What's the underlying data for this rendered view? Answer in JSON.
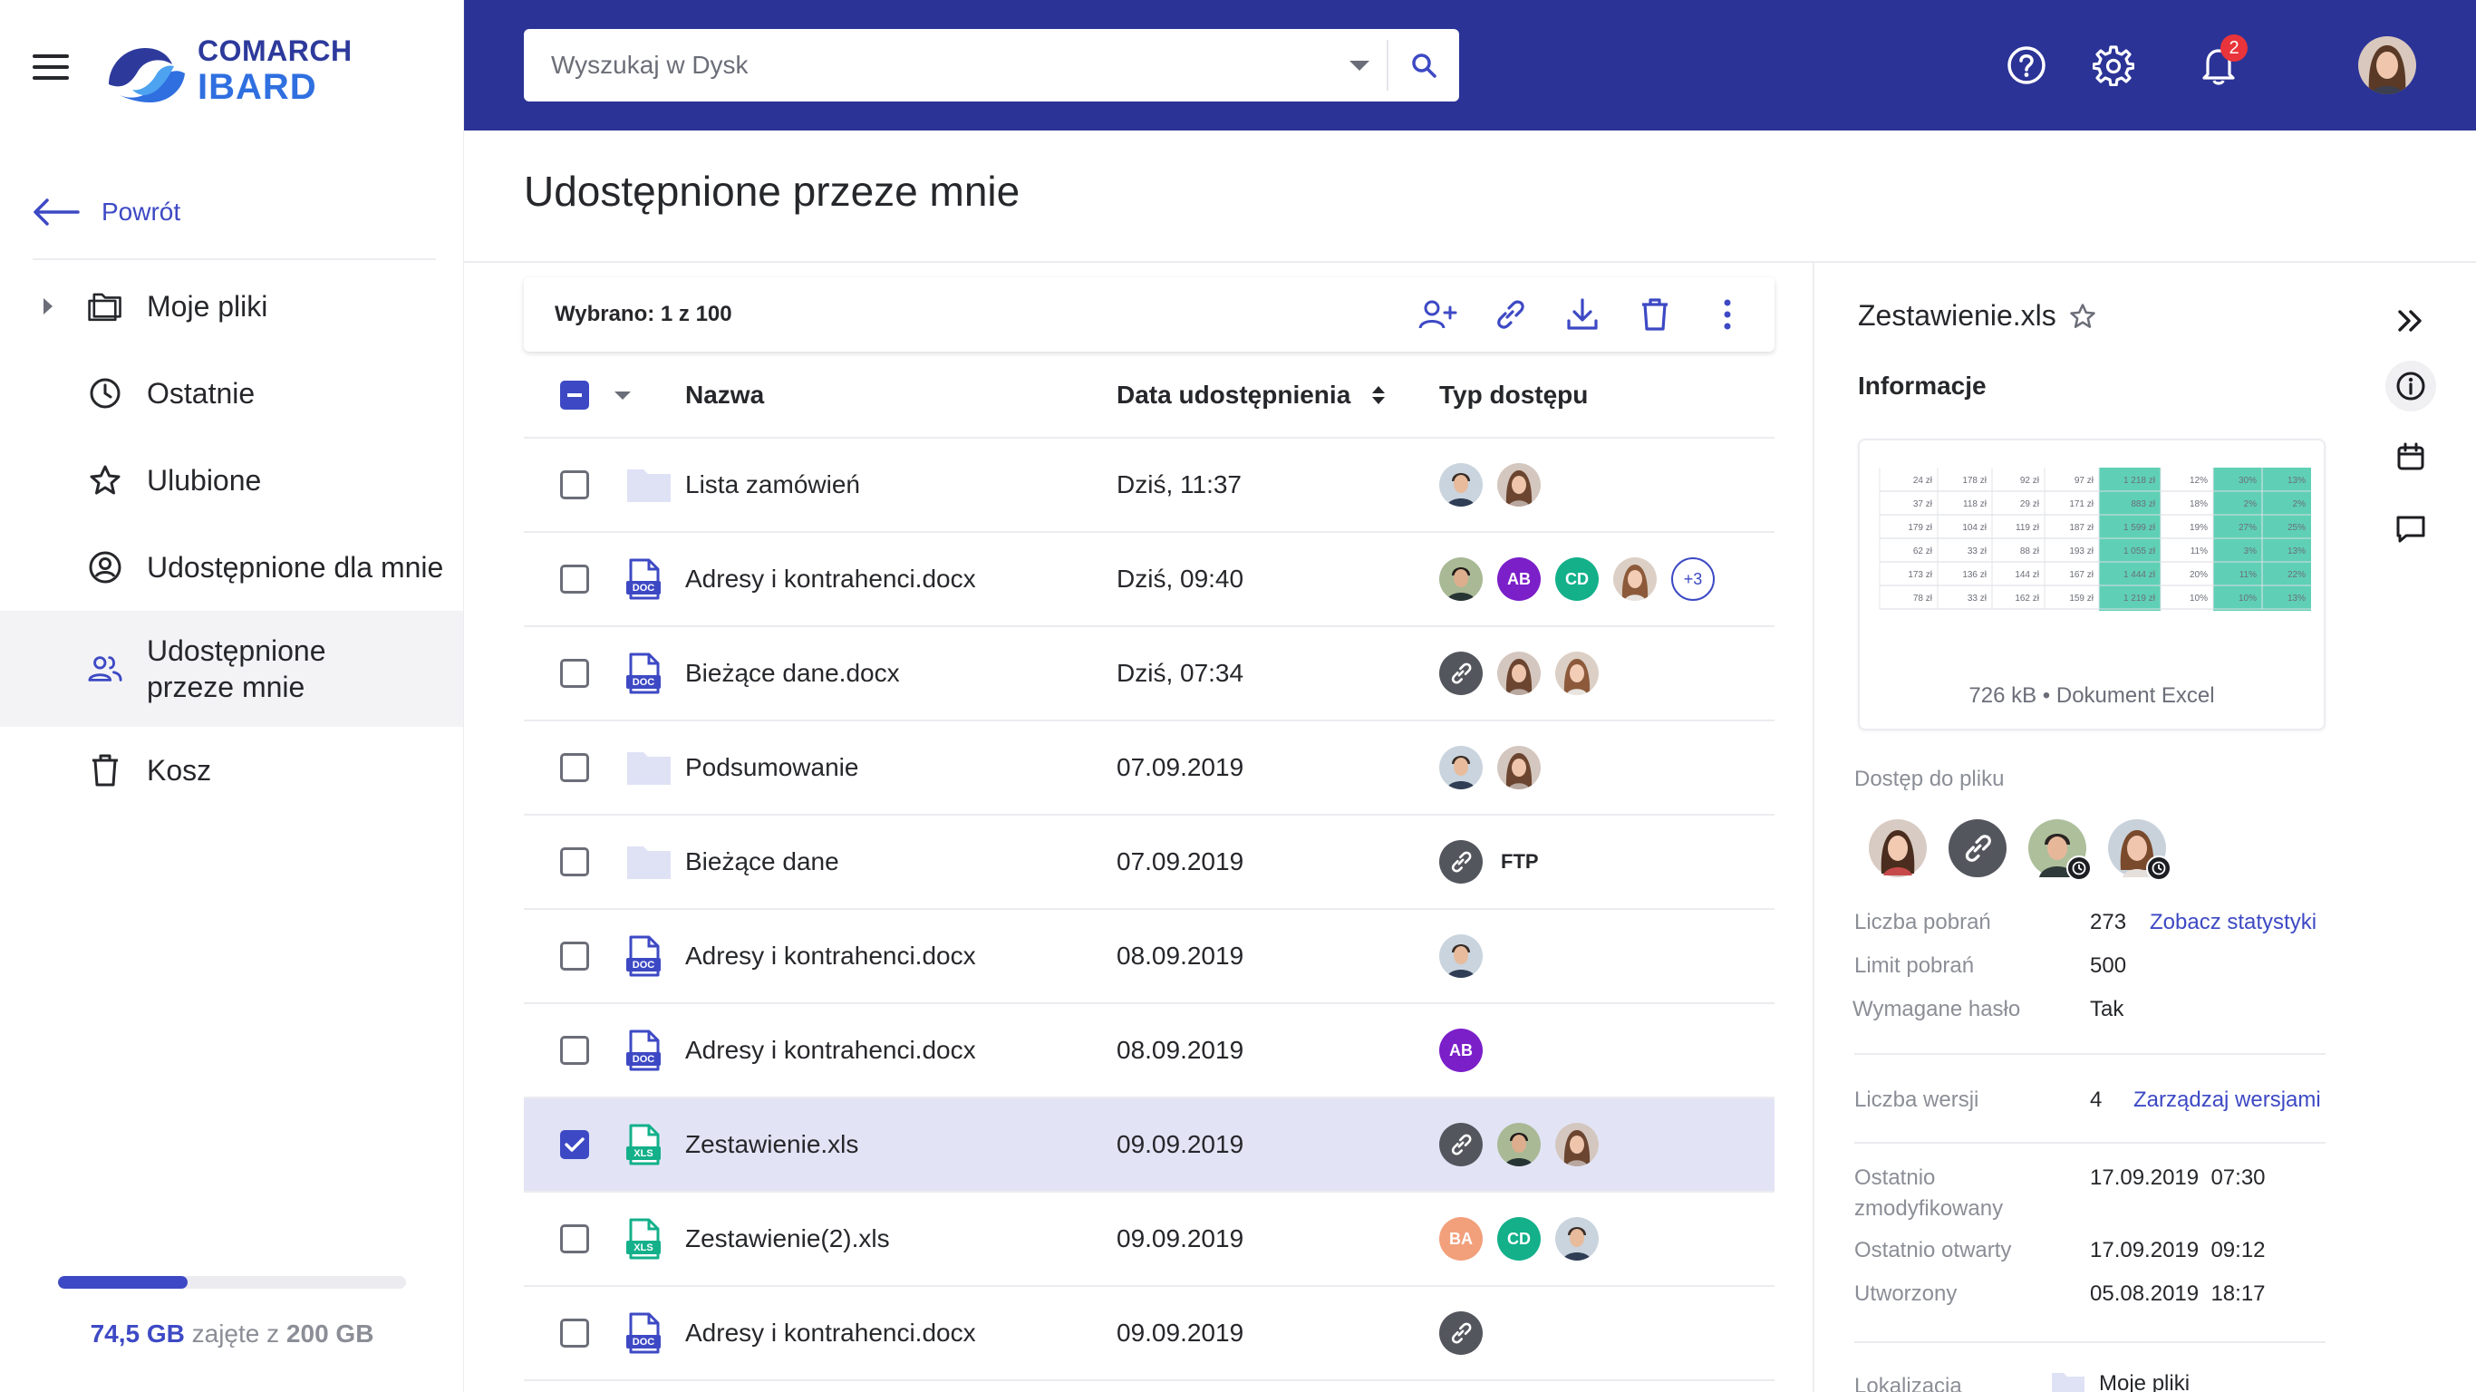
{
  "app": {
    "logo_line1": "COMARCH",
    "logo_line2": "IBARD",
    "accent_color": "#3d49c4",
    "header_color": "#2b3396"
  },
  "header": {
    "search_placeholder": "Wyszukaj w Dysk",
    "notifications_count": "2",
    "icons": [
      "help-icon",
      "settings-icon",
      "bell-icon"
    ]
  },
  "sidebar": {
    "back_label": "Powrót",
    "items": [
      {
        "label": "Moje pliki",
        "icon": "folder-icon",
        "expandable": true
      },
      {
        "label": "Ostatnie",
        "icon": "clock-icon"
      },
      {
        "label": "Ulubione",
        "icon": "star-icon"
      },
      {
        "label": "Udostępnione dla mnie",
        "icon": "user-circle-icon"
      },
      {
        "label": "Udostępnione przeze mnie",
        "icon": "users-icon",
        "active": true
      },
      {
        "label": "Kosz",
        "icon": "trash-icon"
      }
    ],
    "storage": {
      "used": "74,5 GB",
      "middle": "zajęte z",
      "total": "200 GB",
      "fraction": 0.3725
    }
  },
  "page": {
    "title": "Udostępnione przeze mnie"
  },
  "toolbar": {
    "selected_label": "Wybrano: 1 z 100",
    "actions": [
      "add-user-icon",
      "link-icon",
      "download-icon",
      "trash-icon",
      "more-vertical-icon"
    ]
  },
  "table": {
    "columns": {
      "name": "Nazwa",
      "date": "Data udostępnienia",
      "access": "Typ dostępu"
    },
    "rows": [
      {
        "name": "Lista zamówień",
        "type": "folder",
        "date": "Dziś, 11:37",
        "checked": false,
        "access": [
          {
            "kind": "photo",
            "tone": "m1"
          },
          {
            "kind": "photo",
            "tone": "w1"
          }
        ]
      },
      {
        "name": "Adresy i kontrahenci.docx",
        "type": "doc",
        "date": "Dziś, 09:40",
        "checked": false,
        "access": [
          {
            "kind": "photo",
            "tone": "m2"
          },
          {
            "kind": "initials",
            "text": "AB",
            "color": "#7b1fc9"
          },
          {
            "kind": "initials",
            "text": "CD",
            "color": "#13b08a"
          },
          {
            "kind": "photo",
            "tone": "w2"
          },
          {
            "kind": "more",
            "text": "+3"
          }
        ]
      },
      {
        "name": "Bieżące dane.docx",
        "type": "doc",
        "date": "Dziś, 07:34",
        "checked": false,
        "access": [
          {
            "kind": "link"
          },
          {
            "kind": "photo",
            "tone": "w1"
          },
          {
            "kind": "photo",
            "tone": "w2"
          }
        ]
      },
      {
        "name": "Podsumowanie",
        "type": "folder",
        "date": "07.09.2019",
        "checked": false,
        "access": [
          {
            "kind": "photo",
            "tone": "m1"
          },
          {
            "kind": "photo",
            "tone": "w1"
          }
        ]
      },
      {
        "name": "Bieżące dane",
        "type": "folder",
        "date": "07.09.2019",
        "checked": false,
        "access": [
          {
            "kind": "link"
          },
          {
            "kind": "text",
            "text": "FTP"
          }
        ]
      },
      {
        "name": "Adresy i kontrahenci.docx",
        "type": "doc",
        "date": "08.09.2019",
        "checked": false,
        "access": [
          {
            "kind": "photo",
            "tone": "m1"
          }
        ]
      },
      {
        "name": "Adresy i kontrahenci.docx",
        "type": "doc",
        "date": "08.09.2019",
        "checked": false,
        "access": [
          {
            "kind": "initials",
            "text": "AB",
            "color": "#7b1fc9"
          }
        ]
      },
      {
        "name": "Zestawienie.xls",
        "type": "xls",
        "date": "09.09.2019",
        "checked": true,
        "access": [
          {
            "kind": "link"
          },
          {
            "kind": "photo",
            "tone": "m2"
          },
          {
            "kind": "photo",
            "tone": "w1"
          }
        ]
      },
      {
        "name": "Zestawienie(2).xls",
        "type": "xls",
        "date": "09.09.2019",
        "checked": false,
        "access": [
          {
            "kind": "initials",
            "text": "BA",
            "color": "#f2a07b"
          },
          {
            "kind": "initials",
            "text": "CD",
            "color": "#13b08a"
          },
          {
            "kind": "photo",
            "tone": "m1"
          }
        ]
      },
      {
        "name": "Adresy i kontrahenci.docx",
        "type": "doc",
        "date": "09.09.2019",
        "checked": false,
        "access": [
          {
            "kind": "link"
          }
        ]
      }
    ]
  },
  "details": {
    "file_name": "Zestawienie.xls",
    "section_title": "Informacje",
    "size": "726 kB",
    "file_type": "Dokument Excel",
    "access_title": "Dostęp do pliku",
    "downloads_label": "Liczba pobrań",
    "downloads_value": "273",
    "downloads_link": "Zobacz statystyki",
    "limit_label": "Limit pobrań",
    "limit_value": "500",
    "password_label": "Wymagane hasło",
    "password_value": "Tak",
    "versions_label": "Liczba wersji",
    "versions_value": "4",
    "versions_link": "Zarządzaj wersjami",
    "modified_label_1": "Ostatnio",
    "modified_label_2": "zmodyfikowany",
    "modified_value": "17.09.2019  07:30",
    "opened_label": "Ostatnio otwarty",
    "opened_value": "17.09.2019  09:12",
    "created_label": "Utworzony",
    "created_value": "05.08.2019  18:17",
    "location_label": "Lokalizacja",
    "location_value": "Moje pliki",
    "thumbnail_rows": [
      [
        "24 zł",
        "178 zł",
        "92 zł",
        "97 zł",
        "1 218 zł",
        "12%",
        "30%",
        "13%"
      ],
      [
        "37 zł",
        "118 zł",
        "29 zł",
        "171 zł",
        "883 zł",
        "18%",
        "2%",
        "2%"
      ],
      [
        "179 zł",
        "104 zł",
        "119 zł",
        "187 zł",
        "1 599 zł",
        "19%",
        "27%",
        "25%"
      ],
      [
        "62 zł",
        "33 zł",
        "88 zł",
        "193 zł",
        "1 055 zł",
        "11%",
        "3%",
        "13%"
      ],
      [
        "173 zł",
        "136 zł",
        "144 zł",
        "167 zł",
        "1 444 zł",
        "20%",
        "11%",
        "22%"
      ],
      [
        "78 zł",
        "33 zł",
        "162 zł",
        "159 zł",
        "1 219 zł",
        "10%",
        "10%",
        "13%"
      ]
    ]
  },
  "right_rail": [
    "collapse-icon",
    "info-icon",
    "calendar-icon",
    "comment-icon"
  ]
}
